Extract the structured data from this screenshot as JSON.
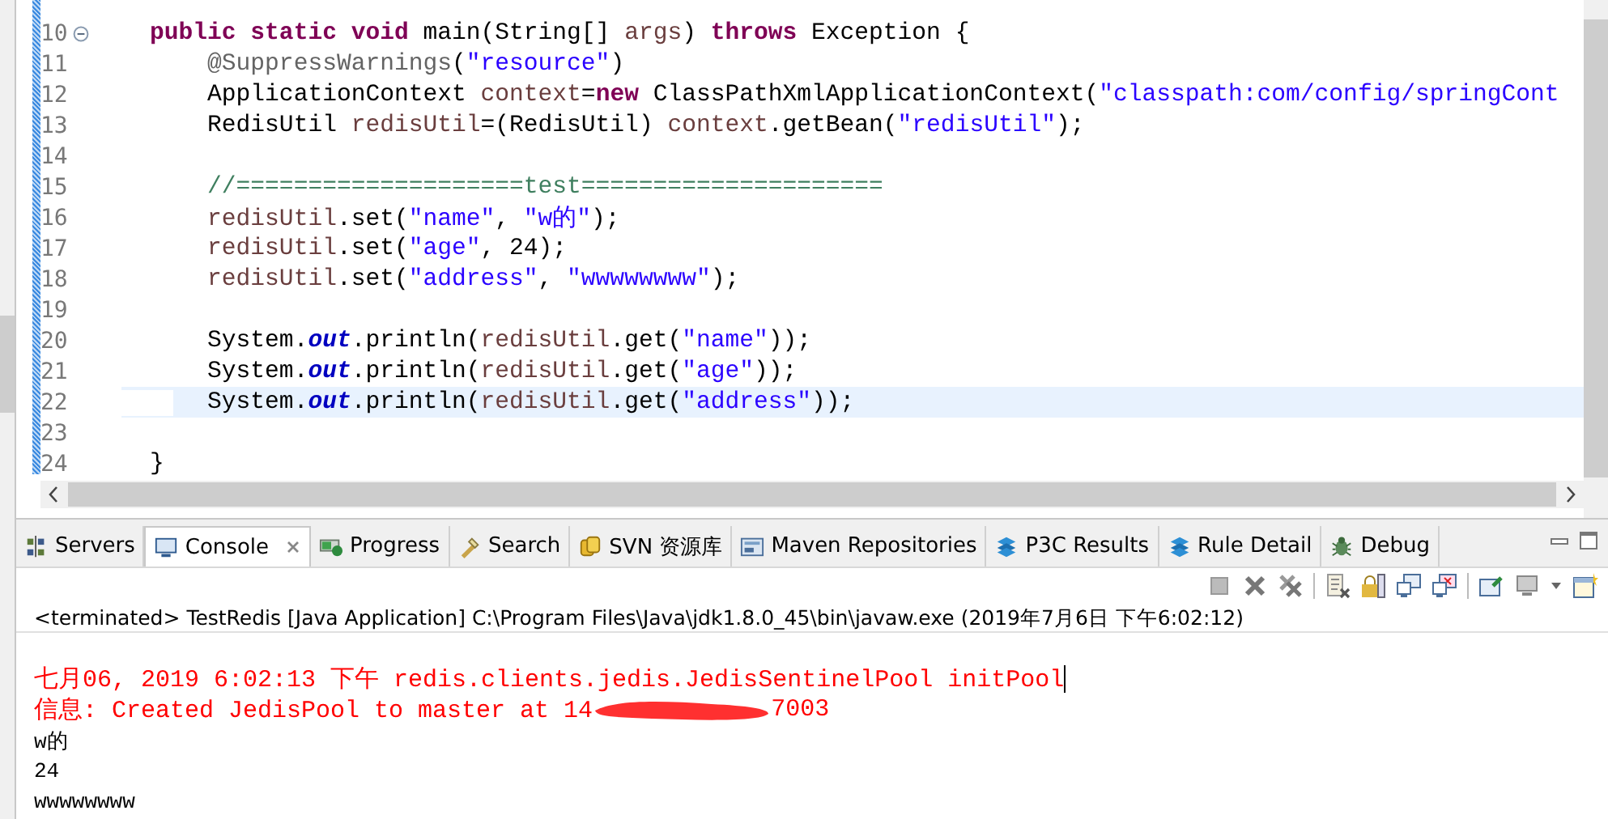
{
  "editor": {
    "lines": [
      {
        "number": "10",
        "fold": true,
        "highlighted": false,
        "tokens": [
          {
            "text": "    public static void",
            "kind": "keyword"
          },
          {
            "text": " main(String[] ",
            "kind": "plain"
          },
          {
            "text": "args",
            "kind": "local"
          },
          {
            "text": ") ",
            "kind": "plain"
          },
          {
            "text": "throws",
            "kind": "keyword"
          },
          {
            "text": " Exception {",
            "kind": "plain"
          }
        ]
      },
      {
        "number": "11",
        "fold": false,
        "highlighted": false,
        "tokens": [
          {
            "text": "        @SuppressWarnings",
            "kind": "annotation"
          },
          {
            "text": "(",
            "kind": "plain"
          },
          {
            "text": "\"resource\"",
            "kind": "string"
          },
          {
            "text": ")",
            "kind": "plain"
          }
        ]
      },
      {
        "number": "12",
        "fold": false,
        "highlighted": false,
        "tokens": [
          {
            "text": "        ApplicationContext ",
            "kind": "plain"
          },
          {
            "text": "context",
            "kind": "local"
          },
          {
            "text": "=",
            "kind": "plain"
          },
          {
            "text": "new",
            "kind": "keyword"
          },
          {
            "text": " ClassPathXmlApplicationContext(",
            "kind": "plain"
          },
          {
            "text": "\"classpath:com/config/springCont",
            "kind": "string"
          }
        ]
      },
      {
        "number": "13",
        "fold": false,
        "highlighted": false,
        "tokens": [
          {
            "text": "        RedisUtil ",
            "kind": "plain"
          },
          {
            "text": "redisUtil",
            "kind": "local"
          },
          {
            "text": "=(RedisUtil) ",
            "kind": "plain"
          },
          {
            "text": "context",
            "kind": "local"
          },
          {
            "text": ".getBean(",
            "kind": "plain"
          },
          {
            "text": "\"redisUtil\"",
            "kind": "string"
          },
          {
            "text": ");",
            "kind": "plain"
          }
        ]
      },
      {
        "number": "14",
        "fold": false,
        "highlighted": false
      },
      {
        "number": "15",
        "fold": false,
        "highlighted": false,
        "tokens": [
          {
            "text": "        //====================test=====================",
            "kind": "comment"
          }
        ]
      },
      {
        "number": "16",
        "fold": false,
        "highlighted": false,
        "tokens": [
          {
            "text": "        redisUtil",
            "kind": "local"
          },
          {
            "text": ".set(",
            "kind": "plain"
          },
          {
            "text": "\"name\"",
            "kind": "string"
          },
          {
            "text": ", ",
            "kind": "plain"
          },
          {
            "text": "\"w的\"",
            "kind": "string"
          },
          {
            "text": ");",
            "kind": "plain"
          }
        ]
      },
      {
        "number": "17",
        "fold": false,
        "highlighted": false,
        "tokens": [
          {
            "text": "        redisUtil",
            "kind": "local"
          },
          {
            "text": ".set(",
            "kind": "plain"
          },
          {
            "text": "\"age\"",
            "kind": "string"
          },
          {
            "text": ", 24);",
            "kind": "plain"
          }
        ]
      },
      {
        "number": "18",
        "fold": false,
        "highlighted": false,
        "tokens": [
          {
            "text": "        redisUtil",
            "kind": "local"
          },
          {
            "text": ".set(",
            "kind": "plain"
          },
          {
            "text": "\"address\"",
            "kind": "string"
          },
          {
            "text": ", ",
            "kind": "plain"
          },
          {
            "text": "\"wwwwwwww\"",
            "kind": "string"
          },
          {
            "text": ");",
            "kind": "plain"
          }
        ]
      },
      {
        "number": "19",
        "fold": false,
        "highlighted": false
      },
      {
        "number": "20",
        "fold": false,
        "highlighted": false,
        "tokens": [
          {
            "text": "        System.",
            "kind": "plain"
          },
          {
            "text": "out",
            "kind": "static"
          },
          {
            "text": ".println(",
            "kind": "plain"
          },
          {
            "text": "redisUtil",
            "kind": "local"
          },
          {
            "text": ".get(",
            "kind": "plain"
          },
          {
            "text": "\"name\"",
            "kind": "string"
          },
          {
            "text": "));",
            "kind": "plain"
          }
        ]
      },
      {
        "number": "21",
        "fold": false,
        "highlighted": false,
        "tokens": [
          {
            "text": "        System.",
            "kind": "plain"
          },
          {
            "text": "out",
            "kind": "static"
          },
          {
            "text": ".println(",
            "kind": "plain"
          },
          {
            "text": "redisUtil",
            "kind": "local"
          },
          {
            "text": ".get(",
            "kind": "plain"
          },
          {
            "text": "\"age\"",
            "kind": "string"
          },
          {
            "text": "));",
            "kind": "plain"
          }
        ]
      },
      {
        "number": "22",
        "fold": false,
        "highlighted": true,
        "tokens": [
          {
            "text": "        System.",
            "kind": "plain"
          },
          {
            "text": "out",
            "kind": "static"
          },
          {
            "text": ".println(",
            "kind": "plain"
          },
          {
            "text": "redisUtil",
            "kind": "local"
          },
          {
            "text": ".get(",
            "kind": "plain"
          },
          {
            "text": "\"address\"",
            "kind": "string"
          },
          {
            "text": "));",
            "kind": "plain"
          }
        ]
      },
      {
        "number": "23",
        "fold": false,
        "highlighted": false
      },
      {
        "number": "24",
        "fold": false,
        "highlighted": false,
        "tokens": [
          {
            "text": "    }",
            "kind": "plain"
          }
        ]
      }
    ]
  },
  "panel": {
    "tabs": [
      {
        "label": "Servers",
        "kind": "servers",
        "selected": false,
        "closable": false
      },
      {
        "label": "Console",
        "kind": "console",
        "selected": true,
        "closable": true
      },
      {
        "label": "Progress",
        "kind": "progress",
        "selected": false,
        "closable": false
      },
      {
        "label": "Search",
        "kind": "search",
        "selected": false,
        "closable": false
      },
      {
        "label": "SVN 资源库",
        "kind": "svn",
        "selected": false,
        "closable": false
      },
      {
        "label": "Maven Repositories",
        "kind": "maven",
        "selected": false,
        "closable": false
      },
      {
        "label": "P3C Results",
        "kind": "p3c",
        "selected": false,
        "closable": false
      },
      {
        "label": "Rule Detail",
        "kind": "p3c",
        "selected": false,
        "closable": false
      },
      {
        "label": "Debug",
        "kind": "debug",
        "selected": false,
        "closable": false
      }
    ],
    "status": "<terminated> TestRedis [Java Application] C:\\Program Files\\Java\\jdk1.8.0_45\\bin\\javaw.exe (2019年7月6日 下午6:02:12)",
    "console": [
      {
        "kind": "error",
        "text": "七月06, 2019 6:02:13 下午 redis.clients.jedis.JedisSentinelPool initPool",
        "caret": true
      },
      {
        "kind": "error",
        "text": "信息: Created JedisPool to master at 14",
        "redacted": true,
        "after": "7003"
      },
      {
        "kind": "output",
        "text": "w的"
      },
      {
        "kind": "output",
        "text": "24"
      },
      {
        "kind": "output",
        "text": "wwwwwwww"
      }
    ]
  }
}
